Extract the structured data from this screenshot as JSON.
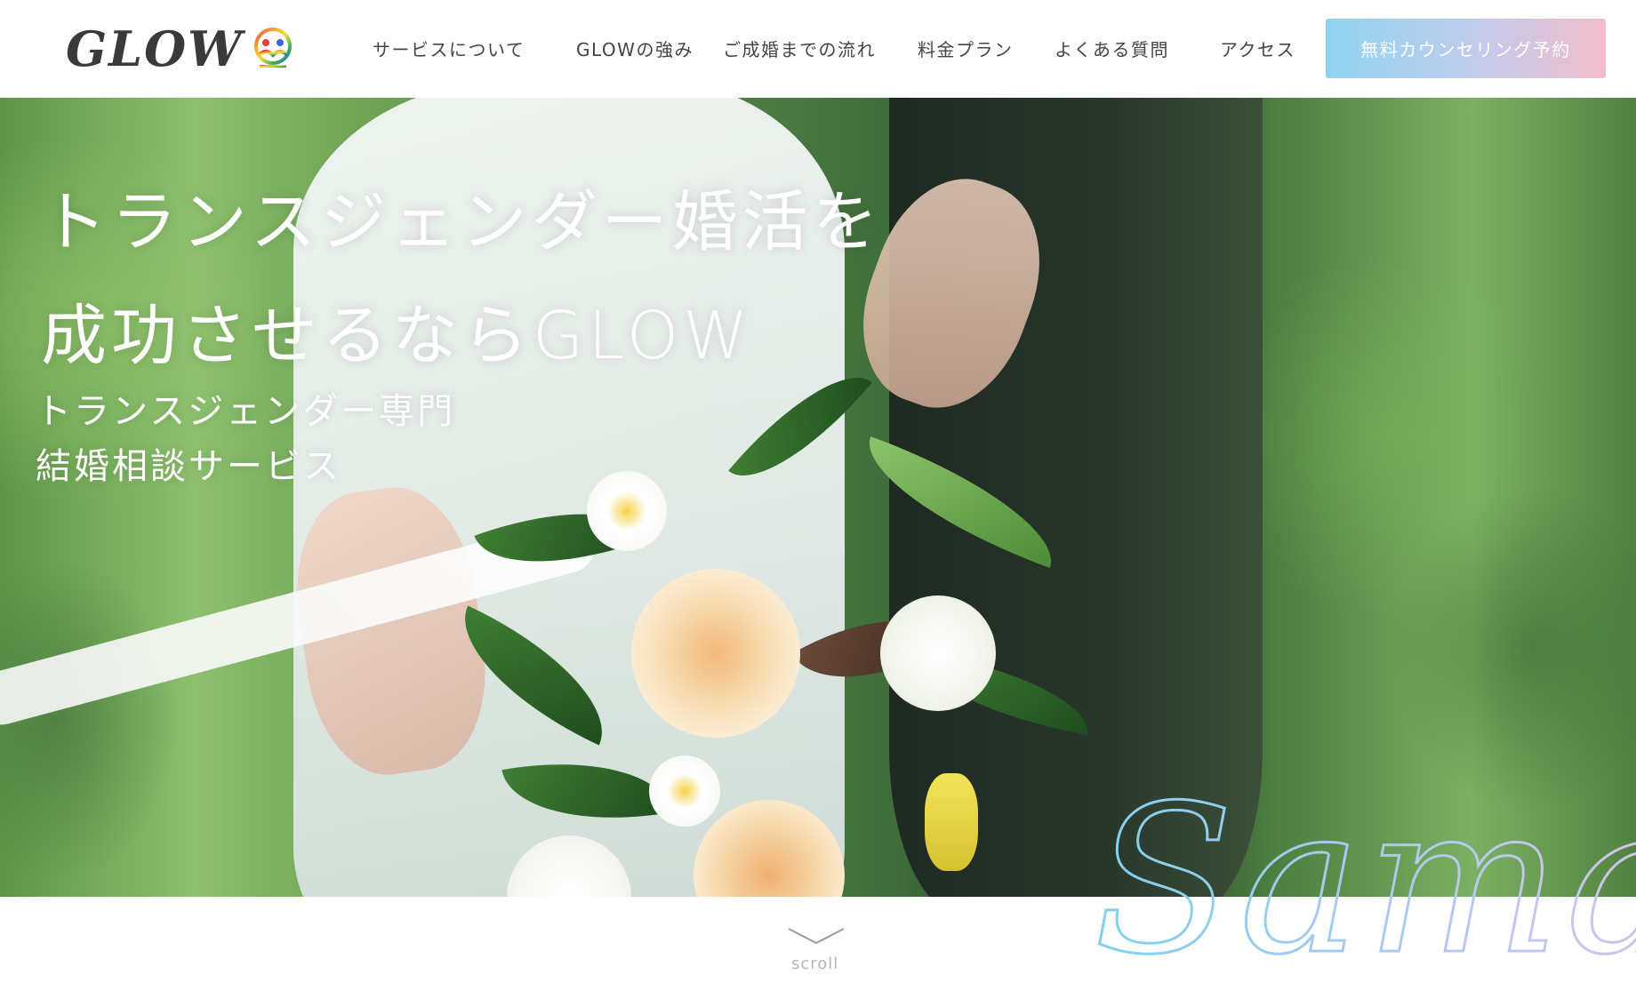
{
  "header": {
    "logo_text": "GLOW",
    "nav": [
      {
        "label": "サービスについて"
      },
      {
        "label": "GLOWの強み"
      },
      {
        "label": "ご成婚までの流れ"
      },
      {
        "label": "料金プラン"
      },
      {
        "label": "よくある質問"
      },
      {
        "label": "アクセス"
      }
    ],
    "cta_label": "無料カウンセリング予約"
  },
  "hero": {
    "title_line1": "トランスジェンダー婚活を",
    "title_line2": "成功させるならGLOW",
    "subtitle_line1": "トランスジェンダー専門",
    "subtitle_line2": "結婚相談サービス"
  },
  "scroll": {
    "label": "scroll"
  },
  "decoration": {
    "script_text": "Samaple"
  },
  "colors": {
    "cta_start": "#8fd3f0",
    "cta_end": "#f4bccb",
    "nav_text": "#444444"
  },
  "icons": {
    "logo_mark": "rainbow-people-icon",
    "scroll": "chevron-down-icon"
  }
}
